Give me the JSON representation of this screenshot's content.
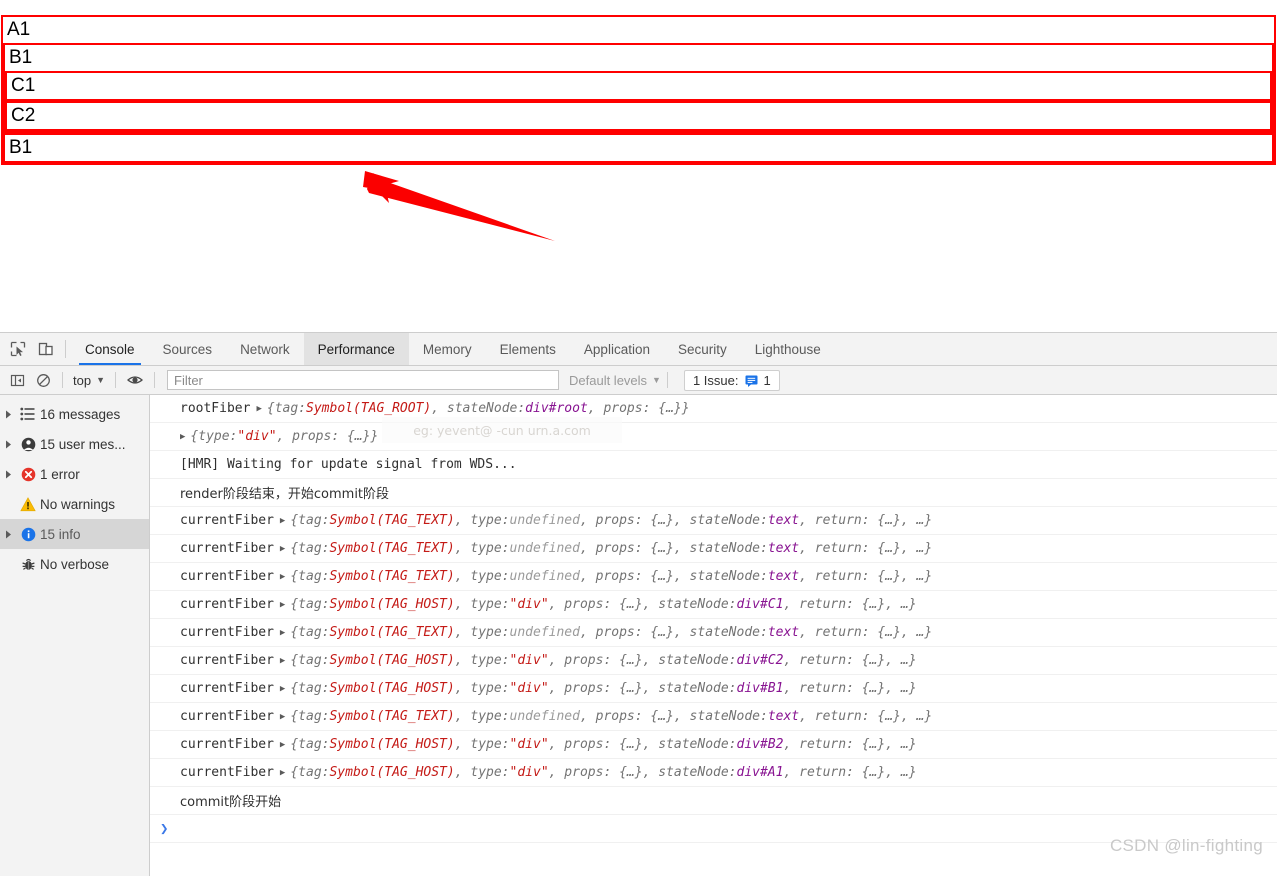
{
  "page": {
    "boxes": {
      "a1_label": "A1",
      "b1_label": "B1",
      "c1_label": "C1",
      "c2_label": "C2",
      "b2_label": "B1"
    },
    "annotation": {
      "name": "red-arrow",
      "color": "#fb0000",
      "points_to": "B1 box"
    }
  },
  "devtools": {
    "tabs": [
      {
        "label": "Console",
        "state": "active"
      },
      {
        "label": "Sources",
        "state": "normal"
      },
      {
        "label": "Network",
        "state": "normal"
      },
      {
        "label": "Performance",
        "state": "hovered"
      },
      {
        "label": "Memory",
        "state": "normal"
      },
      {
        "label": "Elements",
        "state": "normal"
      },
      {
        "label": "Application",
        "state": "normal"
      },
      {
        "label": "Security",
        "state": "normal"
      },
      {
        "label": "Lighthouse",
        "state": "normal"
      }
    ],
    "toolbar_icons": {
      "inspect": "inspect-element-icon",
      "device": "device-toolbar-icon"
    },
    "filterbar": {
      "sidebar_toggle": "console-sidebar-toggle-icon",
      "clear_console": "clear-console-icon",
      "context": "top",
      "context_caret": "▼",
      "eye": "live-expression-icon",
      "filter_placeholder": "Filter",
      "filter_value": "",
      "levels": "Default levels",
      "levels_caret": "▼",
      "issues_label": "1 Issue:",
      "issues_count": "1"
    },
    "sidebar": [
      {
        "label": "16 messages",
        "icon": "list-icon",
        "expandable": true,
        "selected": false
      },
      {
        "label": "15 user mes...",
        "icon": "person-icon",
        "expandable": true,
        "selected": false
      },
      {
        "label": "1 error",
        "icon": "error-icon",
        "expandable": true,
        "selected": false
      },
      {
        "label": "No warnings",
        "icon": "warning-icon",
        "expandable": false,
        "selected": false
      },
      {
        "label": "15 info",
        "icon": "info-icon",
        "expandable": true,
        "selected": true
      },
      {
        "label": "No verbose",
        "icon": "verbose-icon",
        "expandable": false,
        "selected": false
      }
    ],
    "log_rows": [
      {
        "kind": "object",
        "prefix": "rootFiber",
        "triangle": true,
        "parts": [
          {
            "t": "{tag: ",
            "c": "obj"
          },
          {
            "t": "Symbol(TAG_ROOT)",
            "c": "sym"
          },
          {
            "t": ", stateNode: ",
            "c": "obj"
          },
          {
            "t": "div#root",
            "c": "node"
          },
          {
            "t": ", props: {…}}",
            "c": "obj"
          }
        ]
      },
      {
        "kind": "object",
        "prefix": "",
        "triangle": true,
        "parts": [
          {
            "t": "{type: ",
            "c": "obj"
          },
          {
            "t": "\"div\"",
            "c": "str"
          },
          {
            "t": ", props: {…}}",
            "c": "obj"
          }
        ]
      },
      {
        "kind": "text",
        "prefix": "",
        "triangle": false,
        "parts": [
          {
            "t": "[HMR] Waiting for update signal from WDS...",
            "c": "plain"
          }
        ]
      },
      {
        "kind": "text",
        "prefix": "",
        "triangle": false,
        "parts": [
          {
            "t": "render阶段结束，开始commit阶段",
            "c": "plain"
          }
        ]
      },
      {
        "kind": "object",
        "prefix": "currentFiber",
        "triangle": true,
        "parts": [
          {
            "t": "{tag: ",
            "c": "obj"
          },
          {
            "t": "Symbol(TAG_TEXT)",
            "c": "sym"
          },
          {
            "t": ", type: ",
            "c": "obj"
          },
          {
            "t": "undefined",
            "c": "undef"
          },
          {
            "t": ", props: {…}, stateNode: ",
            "c": "obj"
          },
          {
            "t": "text",
            "c": "node"
          },
          {
            "t": ", return: {…}, …}",
            "c": "obj"
          }
        ]
      },
      {
        "kind": "object",
        "prefix": "currentFiber",
        "triangle": true,
        "parts": [
          {
            "t": "{tag: ",
            "c": "obj"
          },
          {
            "t": "Symbol(TAG_TEXT)",
            "c": "sym"
          },
          {
            "t": ", type: ",
            "c": "obj"
          },
          {
            "t": "undefined",
            "c": "undef"
          },
          {
            "t": ", props: {…}, stateNode: ",
            "c": "obj"
          },
          {
            "t": "text",
            "c": "node"
          },
          {
            "t": ", return: {…}, …}",
            "c": "obj"
          }
        ]
      },
      {
        "kind": "object",
        "prefix": "currentFiber",
        "triangle": true,
        "parts": [
          {
            "t": "{tag: ",
            "c": "obj"
          },
          {
            "t": "Symbol(TAG_TEXT)",
            "c": "sym"
          },
          {
            "t": ", type: ",
            "c": "obj"
          },
          {
            "t": "undefined",
            "c": "undef"
          },
          {
            "t": ", props: {…}, stateNode: ",
            "c": "obj"
          },
          {
            "t": "text",
            "c": "node"
          },
          {
            "t": ", return: {…}, …}",
            "c": "obj"
          }
        ]
      },
      {
        "kind": "object",
        "prefix": "currentFiber",
        "triangle": true,
        "parts": [
          {
            "t": "{tag: ",
            "c": "obj"
          },
          {
            "t": "Symbol(TAG_HOST)",
            "c": "sym"
          },
          {
            "t": ", type: ",
            "c": "obj"
          },
          {
            "t": "\"div\"",
            "c": "str"
          },
          {
            "t": ", props: {…}, stateNode: ",
            "c": "obj"
          },
          {
            "t": "div#C1",
            "c": "node"
          },
          {
            "t": ", return: {…}, …}",
            "c": "obj"
          }
        ]
      },
      {
        "kind": "object",
        "prefix": "currentFiber",
        "triangle": true,
        "parts": [
          {
            "t": "{tag: ",
            "c": "obj"
          },
          {
            "t": "Symbol(TAG_TEXT)",
            "c": "sym"
          },
          {
            "t": ", type: ",
            "c": "obj"
          },
          {
            "t": "undefined",
            "c": "undef"
          },
          {
            "t": ", props: {…}, stateNode: ",
            "c": "obj"
          },
          {
            "t": "text",
            "c": "node"
          },
          {
            "t": ", return: {…}, …}",
            "c": "obj"
          }
        ]
      },
      {
        "kind": "object",
        "prefix": "currentFiber",
        "triangle": true,
        "parts": [
          {
            "t": "{tag: ",
            "c": "obj"
          },
          {
            "t": "Symbol(TAG_HOST)",
            "c": "sym"
          },
          {
            "t": ", type: ",
            "c": "obj"
          },
          {
            "t": "\"div\"",
            "c": "str"
          },
          {
            "t": ", props: {…}, stateNode: ",
            "c": "obj"
          },
          {
            "t": "div#C2",
            "c": "node"
          },
          {
            "t": ", return: {…}, …}",
            "c": "obj"
          }
        ]
      },
      {
        "kind": "object",
        "prefix": "currentFiber",
        "triangle": true,
        "parts": [
          {
            "t": "{tag: ",
            "c": "obj"
          },
          {
            "t": "Symbol(TAG_HOST)",
            "c": "sym"
          },
          {
            "t": ", type: ",
            "c": "obj"
          },
          {
            "t": "\"div\"",
            "c": "str"
          },
          {
            "t": ", props: {…}, stateNode: ",
            "c": "obj"
          },
          {
            "t": "div#B1",
            "c": "node"
          },
          {
            "t": ", return: {…}, …}",
            "c": "obj"
          }
        ]
      },
      {
        "kind": "object",
        "prefix": "currentFiber",
        "triangle": true,
        "parts": [
          {
            "t": "{tag: ",
            "c": "obj"
          },
          {
            "t": "Symbol(TAG_TEXT)",
            "c": "sym"
          },
          {
            "t": ", type: ",
            "c": "obj"
          },
          {
            "t": "undefined",
            "c": "undef"
          },
          {
            "t": ", props: {…}, stateNode: ",
            "c": "obj"
          },
          {
            "t": "text",
            "c": "node"
          },
          {
            "t": ", return: {…}, …}",
            "c": "obj"
          }
        ]
      },
      {
        "kind": "object",
        "prefix": "currentFiber",
        "triangle": true,
        "parts": [
          {
            "t": "{tag: ",
            "c": "obj"
          },
          {
            "t": "Symbol(TAG_HOST)",
            "c": "sym"
          },
          {
            "t": ", type: ",
            "c": "obj"
          },
          {
            "t": "\"div\"",
            "c": "str"
          },
          {
            "t": ", props: {…}, stateNode: ",
            "c": "obj"
          },
          {
            "t": "div#B2",
            "c": "node"
          },
          {
            "t": ", return: {…}, …}",
            "c": "obj"
          }
        ]
      },
      {
        "kind": "object",
        "prefix": "currentFiber",
        "triangle": true,
        "parts": [
          {
            "t": "{tag: ",
            "c": "obj"
          },
          {
            "t": "Symbol(TAG_HOST)",
            "c": "sym"
          },
          {
            "t": ", type: ",
            "c": "obj"
          },
          {
            "t": "\"div\"",
            "c": "str"
          },
          {
            "t": ", props: {…}, stateNode: ",
            "c": "obj"
          },
          {
            "t": "div#A1",
            "c": "node"
          },
          {
            "t": ", return: {…}, …}",
            "c": "obj"
          }
        ]
      },
      {
        "kind": "text",
        "prefix": "",
        "triangle": false,
        "parts": [
          {
            "t": "commit阶段开始",
            "c": "plain"
          }
        ]
      }
    ],
    "prompt_caret": "❯",
    "ghost_tooltip": "eg: yevent@ -cun urn.a.com"
  },
  "watermark": "CSDN @lin-fighting",
  "colors": {
    "annotation_red": "#fb0000",
    "box_border": "#ff0000",
    "accent_blue": "#1a73e8",
    "toolbar_bg": "#f3f3f3"
  }
}
